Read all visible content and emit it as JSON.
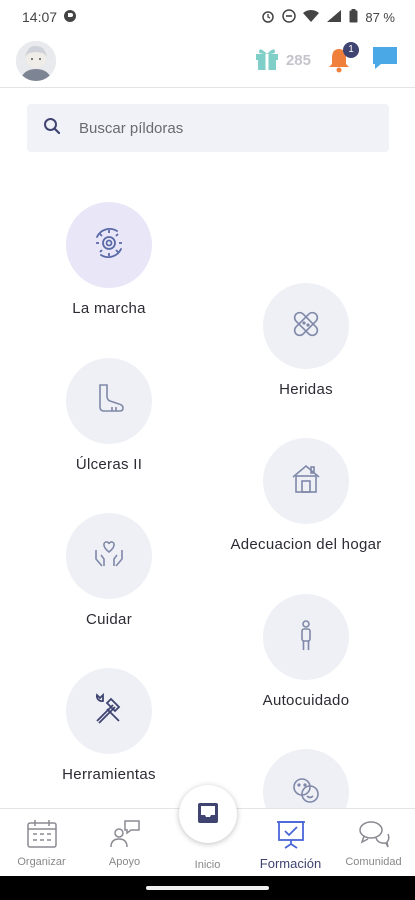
{
  "status_bar": {
    "time": "14:07",
    "battery": "87 %"
  },
  "header": {
    "points": "285",
    "notifications_count": "1"
  },
  "search": {
    "placeholder": "Buscar píldoras"
  },
  "pills": [
    {
      "label": "La marcha",
      "icon": "gears-icon"
    },
    {
      "label": "Heridas",
      "icon": "bandage-icon"
    },
    {
      "label": "Úlceras II",
      "icon": "foot-icon"
    },
    {
      "label": "Adecuacion del hogar",
      "icon": "home-icon"
    },
    {
      "label": "Cuidar",
      "icon": "caring-hands-icon"
    },
    {
      "label": "Autocuidado",
      "icon": "person-icon"
    },
    {
      "label": "Herramientas",
      "icon": "tools-icon"
    },
    {
      "label": "",
      "icon": "faces-icon"
    }
  ],
  "bottom_nav": [
    {
      "label": "Organizar",
      "icon": "calendar-icon"
    },
    {
      "label": "Apoyo",
      "icon": "people-chat-icon"
    },
    {
      "label": "Inicio",
      "icon": "inbox-icon"
    },
    {
      "label": "Formación",
      "icon": "presentation-icon",
      "active": true
    },
    {
      "label": "Comunidad",
      "icon": "chat-bubbles-icon"
    }
  ],
  "colors": {
    "accent": "#3f4470",
    "gift": "#7fcfc8",
    "bell": "#f07f3c",
    "chat": "#4aa8e6",
    "pill_bg": "#eef0f6"
  }
}
